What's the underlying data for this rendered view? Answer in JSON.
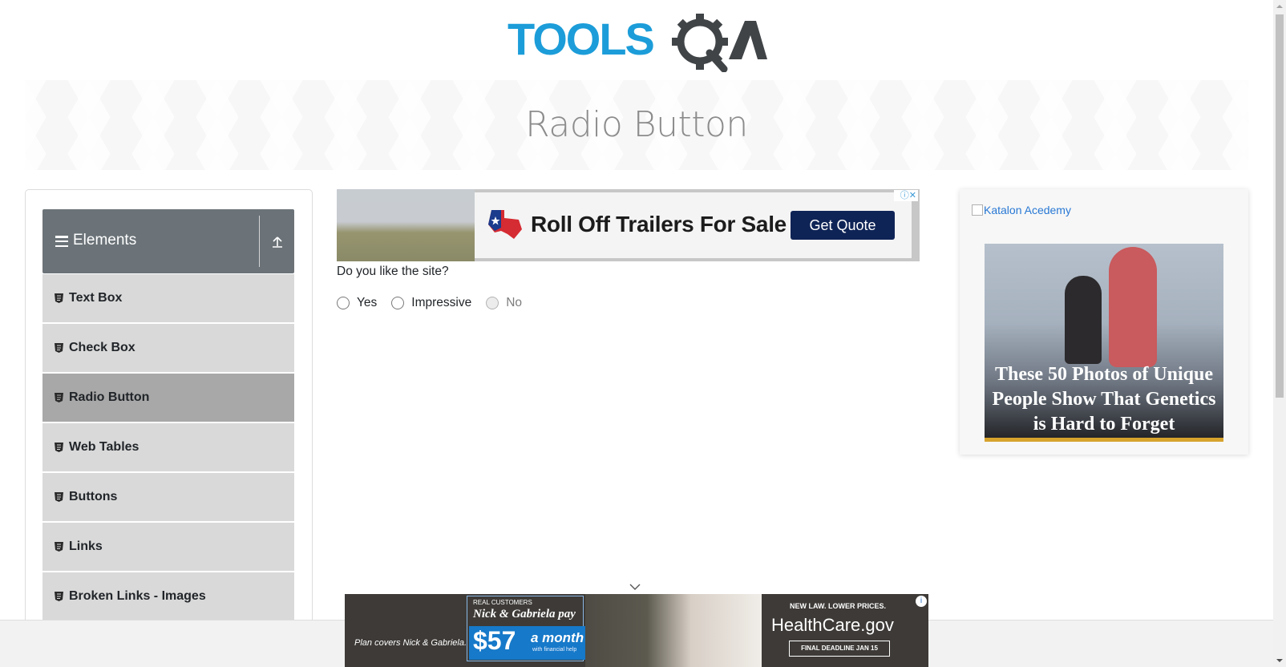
{
  "logo": {
    "part1": "TOOLS",
    "part2": "QA"
  },
  "page_title": "Radio Button",
  "sidebar": {
    "group_title": "Elements",
    "items": [
      {
        "label": "Text Box",
        "active": false
      },
      {
        "label": "Check Box",
        "active": false
      },
      {
        "label": "Radio Button",
        "active": true
      },
      {
        "label": "Web Tables",
        "active": false
      },
      {
        "label": "Buttons",
        "active": false
      },
      {
        "label": "Links",
        "active": false
      },
      {
        "label": "Broken Links - Images",
        "active": false
      }
    ]
  },
  "top_ad": {
    "headline": "Roll Off Trailers For Sale",
    "button": "Get Quote"
  },
  "form": {
    "question": "Do you like the site?",
    "options": [
      {
        "label": "Yes",
        "disabled": false
      },
      {
        "label": "Impressive",
        "disabled": false
      },
      {
        "label": "No",
        "disabled": true
      }
    ]
  },
  "right_ad": {
    "broken_image_alt": "Katalon Acedemy",
    "caption": "These 50 Photos of Unique People Show That Genetics is Hard to Forget"
  },
  "bottom_ad": {
    "plan": "Plan covers Nick & Gabriela.",
    "real_customers": "REAL CUSTOMERS",
    "names": "Nick & Gabriela pay",
    "price": "$57",
    "period": "a month",
    "help": "with financial help",
    "new_law": "NEW LAW. LOWER PRICES.",
    "brand": "HealthCare.gov",
    "deadline": "FINAL DEADLINE JAN 15"
  },
  "colors": {
    "logo_blue": "#1c9dd9",
    "logo_dark": "#404447",
    "sidebar_header": "#6b7378",
    "active_item": "#a8a8a8",
    "item_bg": "#d9d9d9"
  }
}
